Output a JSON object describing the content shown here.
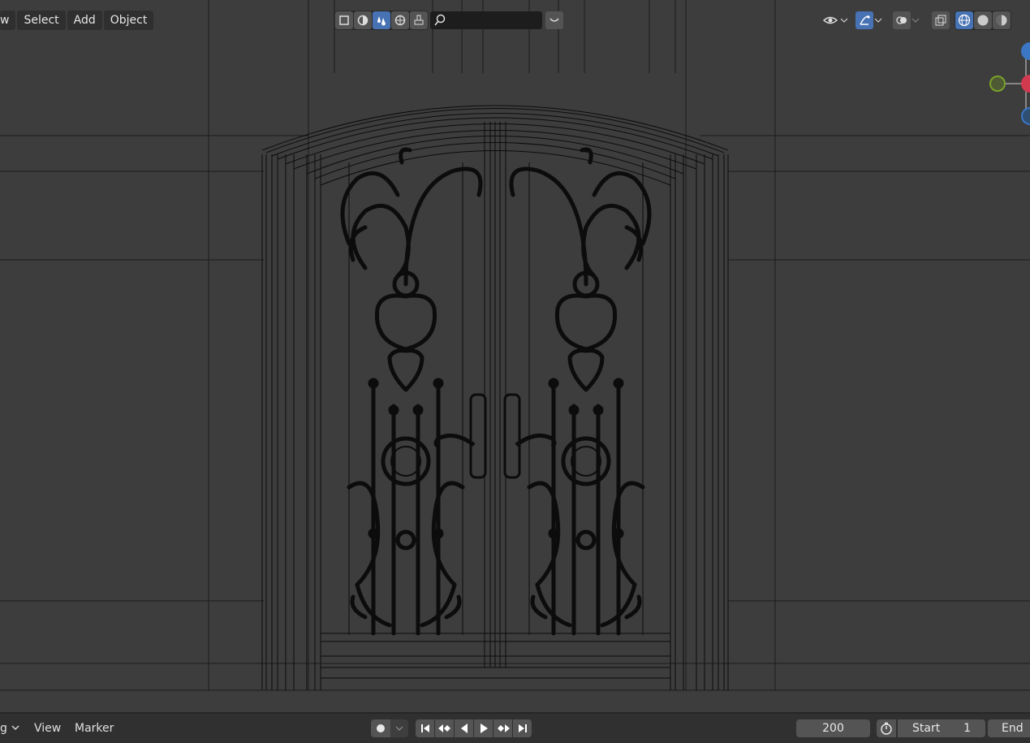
{
  "viewport_menu": {
    "view_label": "w",
    "select_label": "Select",
    "add_label": "Add",
    "object_label": "Object"
  },
  "header_center": {
    "icons": [
      "toggle-xray-icon",
      "solid-shading-icon",
      "material-preview-icon",
      "rendered-icon",
      "brush-icon",
      "search-icon"
    ],
    "search_placeholder": ""
  },
  "header_right": {
    "icons": [
      "visibility-icon",
      "gizmo-icon",
      "overlay-icon",
      "xray-icon",
      "wireframe-shading-icon",
      "solid-shading-icon",
      "material-shading-icon"
    ]
  },
  "gizmo": {
    "axes": [
      "Z",
      "X",
      "Y"
    ],
    "colors": {
      "x": "#d43a4f",
      "y": "#7aa02b",
      "z": "#3b77c4"
    }
  },
  "timeline": {
    "mode_label": "g",
    "view_label": "View",
    "marker_label": "Marker",
    "current_frame": "200",
    "start_label": "Start",
    "start_value": "1",
    "end_label": "End"
  },
  "colors": {
    "background": "#3d3d3d",
    "wire": "#0c0c0c",
    "active": "#4772b3"
  }
}
